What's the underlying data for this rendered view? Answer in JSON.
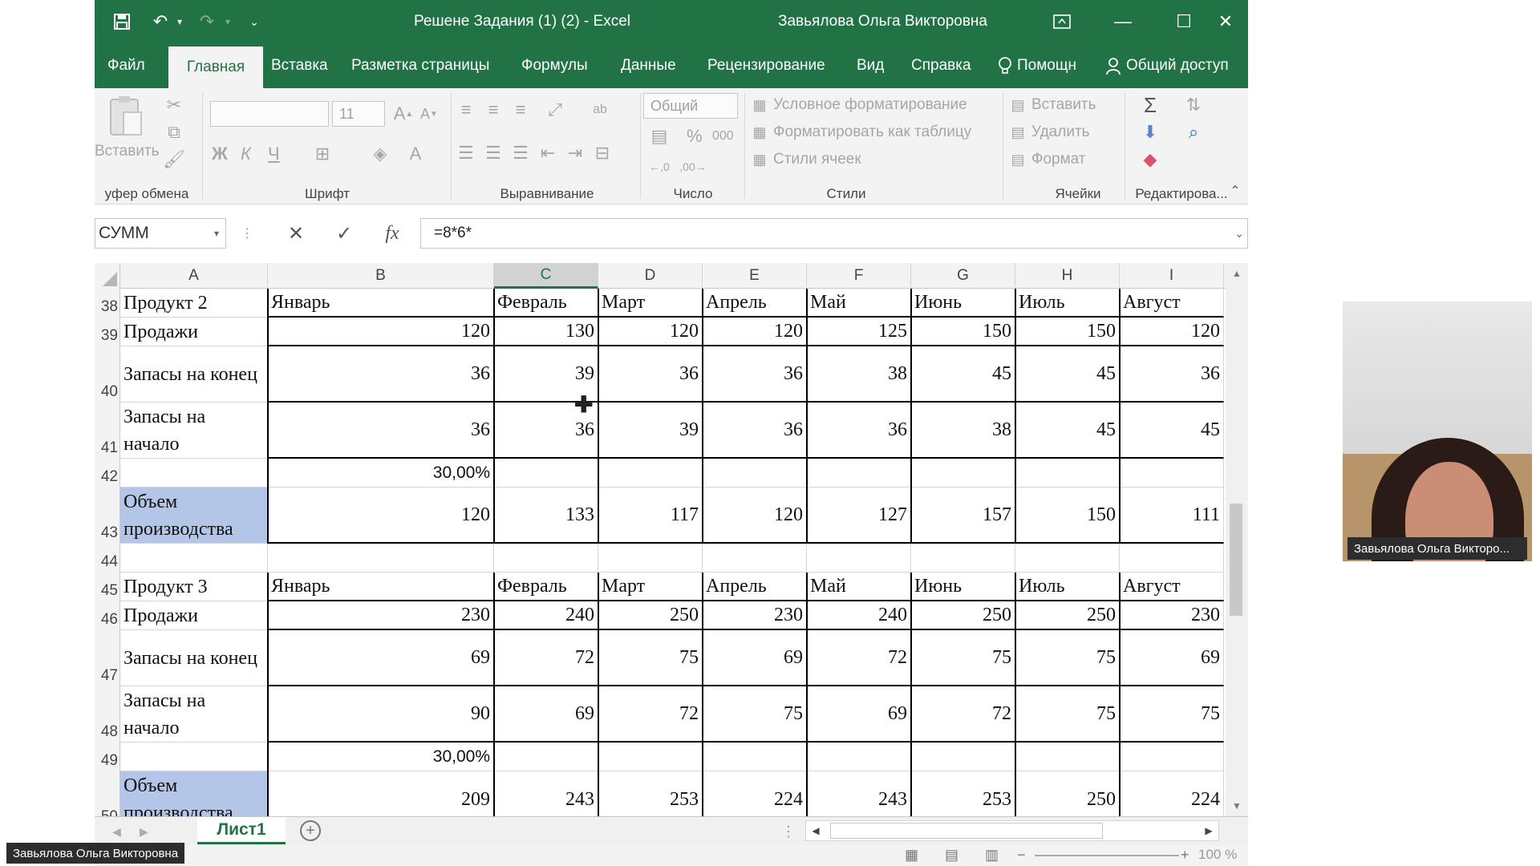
{
  "title_bar": {
    "document_title": "Решене Задания (1) (2)  -  Excel",
    "user_name": "Завьялова Ольга Викторовна",
    "qat_icons": [
      "save-icon",
      "undo-icon",
      "redo-icon",
      "customize-icon"
    ],
    "window_icons": [
      "ribbon-display-icon",
      "minimize-icon",
      "maximize-icon",
      "close-icon"
    ]
  },
  "ribbon_tabs": [
    "Файл",
    "Главная",
    "Вставка",
    "Разметка страницы",
    "Формулы",
    "Данные",
    "Рецензирование",
    "Вид",
    "Справка",
    "Помощн",
    "Общий доступ"
  ],
  "active_tab": "Главная",
  "ribbon": {
    "clipboard": {
      "label": "уфер обмена",
      "paste": "Вставить"
    },
    "font": {
      "label": "Шрифт",
      "font_name": "",
      "font_size": "11",
      "bold": "Ж",
      "italic": "К",
      "underline": "Ч"
    },
    "alignment": {
      "label": "Выравнивание"
    },
    "number": {
      "label": "Число",
      "format": "Общий",
      "percent": "%",
      "thousands": "000"
    },
    "styles": {
      "label": "Стили",
      "conditional": "Условное форматирование",
      "as_table": "Форматировать как таблицу",
      "cell_styles": "Стили ячеек"
    },
    "cells": {
      "label": "Ячейки",
      "insert": "Вставить",
      "delete": "Удалить",
      "format": "Формат"
    },
    "editing": {
      "label": "Редактирова..."
    }
  },
  "formula_bar": {
    "name_box": "СУММ",
    "formula": "=8*6*"
  },
  "sheet": {
    "columns": [
      "A",
      "B",
      "C",
      "D",
      "E",
      "F",
      "G",
      "H",
      "I"
    ],
    "selected_column": "C",
    "rows": [
      {
        "num": "38",
        "cells": [
          "Продукт 2",
          "Январь",
          "Февраль",
          "Март",
          "Апрель",
          "Май",
          "Июнь",
          "Июль",
          "Август"
        ]
      },
      {
        "num": "39",
        "cells": [
          "Продажи",
          "120",
          "130",
          "120",
          "120",
          "125",
          "150",
          "150",
          "120"
        ]
      },
      {
        "num": "40",
        "cells": [
          "Запасы на конец",
          "36",
          "39",
          "36",
          "36",
          "38",
          "45",
          "45",
          "36"
        ]
      },
      {
        "num": "41",
        "cells": [
          "Запасы на начало",
          "36",
          "36",
          "39",
          "36",
          "36",
          "38",
          "45",
          "45"
        ]
      },
      {
        "num": "42",
        "cells": [
          "",
          "30,00%",
          "",
          "",
          "",
          "",
          "",
          "",
          ""
        ]
      },
      {
        "num": "43",
        "cells": [
          "Объем производства",
          "120",
          "133",
          "117",
          "120",
          "127",
          "157",
          "150",
          "111"
        ]
      },
      {
        "num": "44",
        "cells": [
          "",
          "",
          "",
          "",
          "",
          "",
          "",
          "",
          ""
        ]
      },
      {
        "num": "45",
        "cells": [
          "Продукт 3",
          "Январь",
          "Февраль",
          "Март",
          "Апрель",
          "Май",
          "Июнь",
          "Июль",
          "Август"
        ]
      },
      {
        "num": "46",
        "cells": [
          "Продажи",
          "230",
          "240",
          "250",
          "230",
          "240",
          "250",
          "250",
          "230"
        ]
      },
      {
        "num": "47",
        "cells": [
          "Запасы на конец",
          "69",
          "72",
          "75",
          "69",
          "72",
          "75",
          "75",
          "69"
        ]
      },
      {
        "num": "48",
        "cells": [
          "Запасы на начало",
          "90",
          "69",
          "72",
          "75",
          "69",
          "72",
          "75",
          "75"
        ]
      },
      {
        "num": "49",
        "cells": [
          "",
          "30,00%",
          "",
          "",
          "",
          "",
          "",
          "",
          ""
        ]
      },
      {
        "num": "50",
        "cells": [
          "Объем производства",
          "209",
          "243",
          "253",
          "224",
          "243",
          "253",
          "250",
          "224"
        ]
      }
    ]
  },
  "sheet_tabs": {
    "active": "Лист1",
    "add_icon": "plus-circle-icon"
  },
  "status_bar": {
    "zoom": "100 %"
  },
  "webcam": {
    "participant_name": "Завьялова Ольга Викторо..."
  },
  "presenter": {
    "name": "Завьялова Ольга Викторовна"
  },
  "colors": {
    "excel_green": "#217346",
    "highlight_blue": "#b4c6e7",
    "ribbon_bg": "#f3f3f3"
  }
}
